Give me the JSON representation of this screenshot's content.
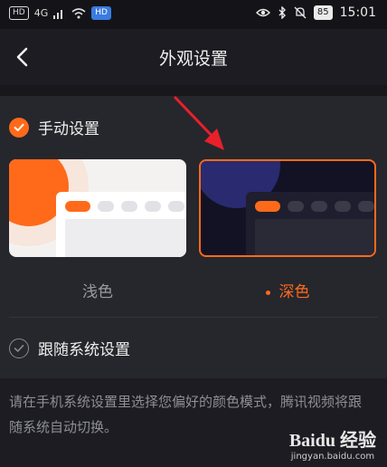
{
  "status": {
    "left_labels": [
      "HD",
      "4G",
      "HD"
    ],
    "battery": "85",
    "time": "15:01"
  },
  "header": {
    "title": "外观设置"
  },
  "appearance": {
    "manual_label": "手动设置",
    "light_label": "浅色",
    "dark_label": "深色",
    "selected": "dark",
    "follow_label": "跟随系统设置"
  },
  "note": "请在手机系统设置里选择您偏好的颜色模式，腾讯视频将跟随系统自动切换。",
  "watermark": {
    "brand": "Baidu 经验",
    "url": "jingyan.baidu.com"
  },
  "colors": {
    "accent": "#ff6a1a",
    "annotation_arrow": "#e8202a"
  }
}
